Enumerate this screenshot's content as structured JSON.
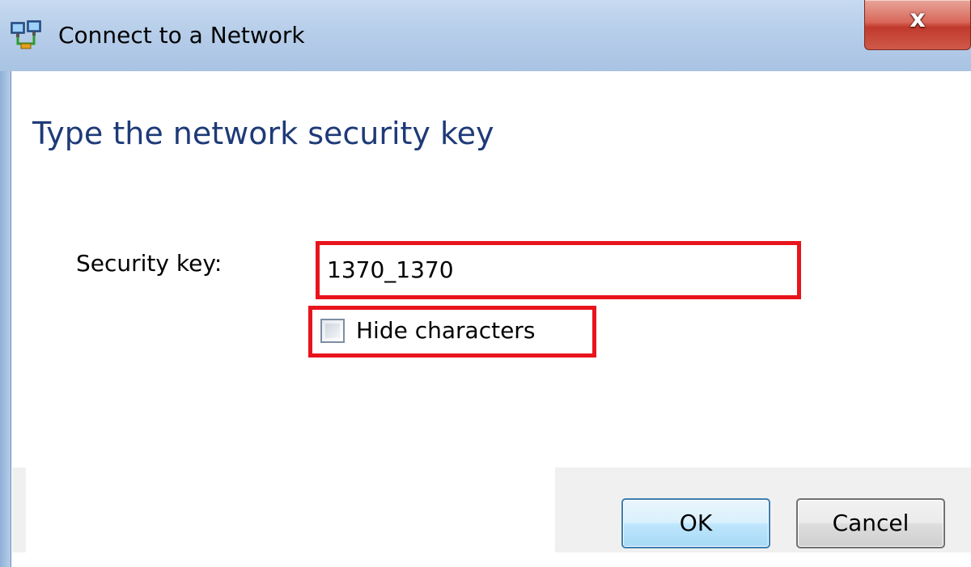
{
  "window": {
    "title": "Connect to a Network",
    "close_glyph": "x",
    "icon": "network-connect-icon"
  },
  "main": {
    "heading": "Type the network security key",
    "security_key_label": "Security key:",
    "security_key_value": "1370_1370",
    "hide_characters_label": "Hide characters",
    "hide_characters_checked": false
  },
  "footer": {
    "ok_label": "OK",
    "cancel_label": "Cancel"
  },
  "colors": {
    "heading": "#1e3a78",
    "highlight": "#e8141c",
    "ok_border": "#3c7fb1"
  }
}
